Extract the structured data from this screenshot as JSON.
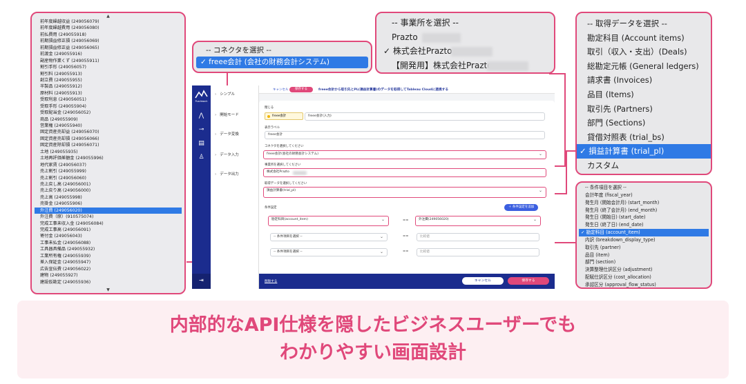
{
  "account_list": {
    "items": [
      "前年度繰越収益 (249056079)",
      "前年度繰越費用 (249056080)",
      "前払費用 (249055918)",
      "前期損益修正損 (249056069)",
      "前期損益修正益 (249056065)",
      "前渡金 (249055916)",
      "副産物作業くず (249055911)",
      "割引手形 (249056057)",
      "割引料 (249055913)",
      "創立費 (249055955)",
      "半製品 (249055912)",
      "原材料 (249055913)",
      "受取利息 (249056051)",
      "受取手形 (249055904)",
      "受取配当金 (249056052)",
      "商品 (249055909)",
      "営業権 (249055940)",
      "固定資産売却益 (249056070)",
      "固定資産売却損 (249056066)",
      "固定資産除却損 (249056071)",
      "土地 (249055935)",
      "土地再評価差額金 (249055996)",
      "地代家賃 (249056037)",
      "売上割引 (249055999)",
      "売上割引 (249056060)",
      "売上戻し高 (249056001)",
      "売上戻り高 (249056000)",
      "売上高 (249055998)",
      "売掛金 (249055906)",
      "外注費 (249056020)",
      "外注費（原）(910575074)",
      "完成工事未収入金 (249056084)",
      "完成工事高 (249056091)",
      "寄付金 (249056043)",
      "工事未払金 (249056088)",
      "工具器具備品 (249055932)",
      "工業所有権 (249055939)",
      "差入保証金 (249055947)",
      "広告宣伝費 (249056022)",
      "建物 (249055927)",
      "建設仮勘定 (249055936)"
    ],
    "selected": "外注費 (249056020)",
    "scroll_up": "▲",
    "scroll_down": "▼"
  },
  "connector_dropdown": {
    "placeholder": "-- コネクタを選択 --",
    "selected": "✓ freee会計 (会社の財務会計システム)"
  },
  "office_dropdown": {
    "placeholder": "-- 事業所を選択 --",
    "items": [
      "Prazto",
      "✓ 株式会社Prazto",
      "【開発用】株式会社Prazto"
    ]
  },
  "datatype_dropdown": {
    "items": [
      "-- 取得データを選択 --",
      "勘定科目 (Account items)",
      "取引（収入・支出）(Deals)",
      "総勘定元帳 (General ledgers)",
      "請求書 (Invoices)",
      "品目 (Items)",
      "取引先 (Partners)",
      "部門 (Sections)",
      "貸借対照表 (trial_bs)",
      "✓ 損益計算書 (trial_pl)",
      "カスタム"
    ],
    "selected_index": 9
  },
  "condition_dropdown": {
    "items": [
      "-- 条件項目を選択 --",
      "会計年度 (fiscal_year)",
      "発生月 (開始会計月) (start_month)",
      "発生月 (終了会計月) (end_month)",
      "発生日 (開始日) (start_date)",
      "発生日 (終了日) (end_date)",
      "✓ 勘定科目 (account_item)",
      "内訳 (breakdown_display_type)",
      "取引先 (partner)",
      "品目 (item)",
      "部門 (section)",
      "決算整理仕訳区分 (adjustment)",
      "配賦仕訳区分 (cost_allocation)",
      "承認区分 (approval_flow_status)"
    ],
    "selected_index": 6
  },
  "app": {
    "logo_text": "Puzzlework",
    "side_menu": [
      "シンプル",
      "開始モード",
      "データ変換",
      "データ入力",
      "データ出力"
    ],
    "topbar": {
      "cancel": "キャンセル",
      "save": "保存する",
      "title": "freee会計から取引先とPL(損益計算書)のデータを取得してTableau Cloudに連携する"
    },
    "form": {
      "close": "閉じる",
      "chip_label": "freee会計",
      "chip_desc": "freee会計(入力)",
      "display_label": "表示ラベル",
      "display_value": "freee会計",
      "connector_label": "コネクタを選択してください",
      "connector_value": "freee会計(会社の財務会計システム)",
      "office_label": "事業所を選択してください",
      "office_value": "株式会社Prazto",
      "datatype_label": "取得データを選択してください",
      "datatype_value": "損益計算書(trial_pl)",
      "conditions_label": "条件設定",
      "add_condition": "＋ 条件設定を追加",
      "cond_rows": [
        {
          "field": "勘定科目(account_item)",
          "op": "==",
          "value": "外注費(249056020)"
        },
        {
          "field": "-- 条件項目を選択 --",
          "op": "==",
          "value": "比較値"
        },
        {
          "field": "-- 条件項目を選択 --",
          "op": "==",
          "value": "比較値"
        }
      ]
    },
    "footer": {
      "delete": "削除する",
      "cancel": "キャンセル",
      "save": "保存する"
    }
  },
  "banner": {
    "line1": "内部的なAPI仕様を隠したビジネスユーザーでも",
    "line2": "わかりやすい画面設計"
  },
  "colors": {
    "accent": "#e0487a",
    "nav": "#1b2c8e",
    "select": "#2f7ae5",
    "banner_bg": "#fdeff2"
  }
}
